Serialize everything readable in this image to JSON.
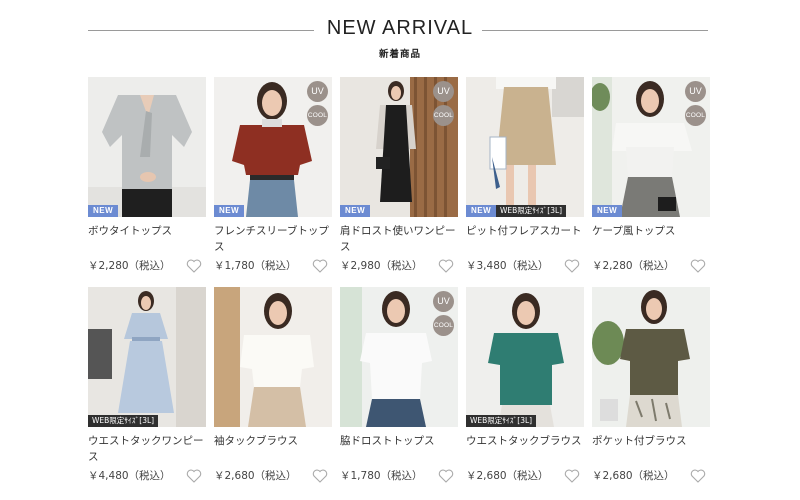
{
  "section": {
    "title": "NEW ARRIVAL",
    "subtitle": "新着商品"
  },
  "colors": {
    "uv_badge": "#9b918b",
    "new_badge": "#6c8bd2",
    "web_badge": "#2f2f2f"
  },
  "badge_text": {
    "uv": "UV",
    "cool": "COOL",
    "new": "NEW",
    "web": "WEB限定ｻｲｽﾞ[3L]"
  },
  "products": [
    {
      "name": "ボウタイトップス",
      "price": "￥2,280（税込）",
      "uv": false,
      "cool": false,
      "new": true,
      "web": false
    },
    {
      "name": "フレンチスリーブトップス",
      "price": "￥1,780（税込）",
      "uv": true,
      "cool": true,
      "new": true,
      "web": false
    },
    {
      "name": "肩ドロスト使いワンピース",
      "price": "￥2,980（税込）",
      "uv": true,
      "cool": true,
      "new": true,
      "web": false
    },
    {
      "name": "ピット付フレアスカート",
      "price": "￥3,480（税込）",
      "uv": false,
      "cool": false,
      "new": true,
      "web": true
    },
    {
      "name": "ケープ風トップス",
      "price": "￥2,280（税込）",
      "uv": true,
      "cool": true,
      "new": true,
      "web": false
    },
    {
      "name": "ウエストタックワンピース",
      "price": "￥4,480（税込）",
      "uv": false,
      "cool": false,
      "new": false,
      "web": true
    },
    {
      "name": "袖タックブラウス",
      "price": "￥2,680（税込）",
      "uv": false,
      "cool": false,
      "new": false,
      "web": false
    },
    {
      "name": "脇ドロストトップス",
      "price": "￥1,780（税込）",
      "uv": true,
      "cool": true,
      "new": false,
      "web": false
    },
    {
      "name": "ウエストタックブラウス",
      "price": "￥2,680（税込）",
      "uv": false,
      "cool": false,
      "new": false,
      "web": true
    },
    {
      "name": "ポケット付ブラウス",
      "price": "￥2,680（税込）",
      "uv": false,
      "cool": false,
      "new": false,
      "web": false
    }
  ]
}
